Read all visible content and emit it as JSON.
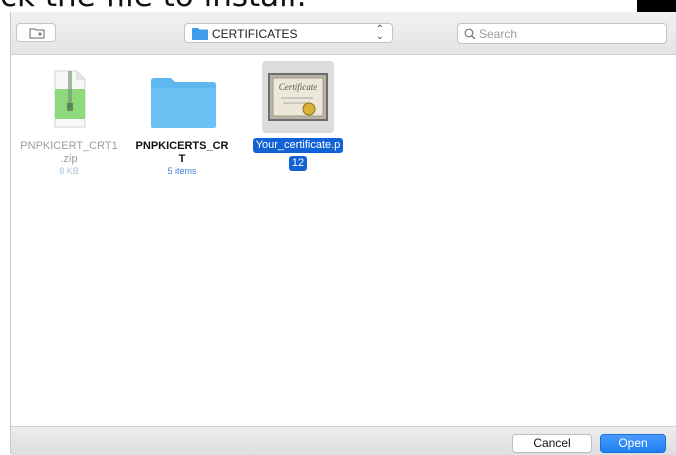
{
  "background_text": "ck the file to install:",
  "toolbar": {
    "location": "CERTIFICATES",
    "search_placeholder": "Search",
    "new_folder_icon": "new-folder-icon"
  },
  "files": [
    {
      "name_line1": "PNPKICERT_CRT1",
      "name_line2": ".zip",
      "meta": "8 KB",
      "icon": "zip-file-icon"
    },
    {
      "name_line1": "PNPKICERTS_CR",
      "name_line2": "T",
      "meta": "5 items",
      "icon": "folder-icon"
    },
    {
      "name_line1": "Your_certificate.p",
      "name_line2": "12",
      "selected": true,
      "icon": "certificate-icon",
      "icon_text": "Certificate"
    }
  ],
  "footer": {
    "cancel": "Cancel",
    "open": "Open"
  },
  "colors": {
    "accent": "#1f7ff5",
    "selection": "#1062d6",
    "folder": "#5db8f0"
  }
}
